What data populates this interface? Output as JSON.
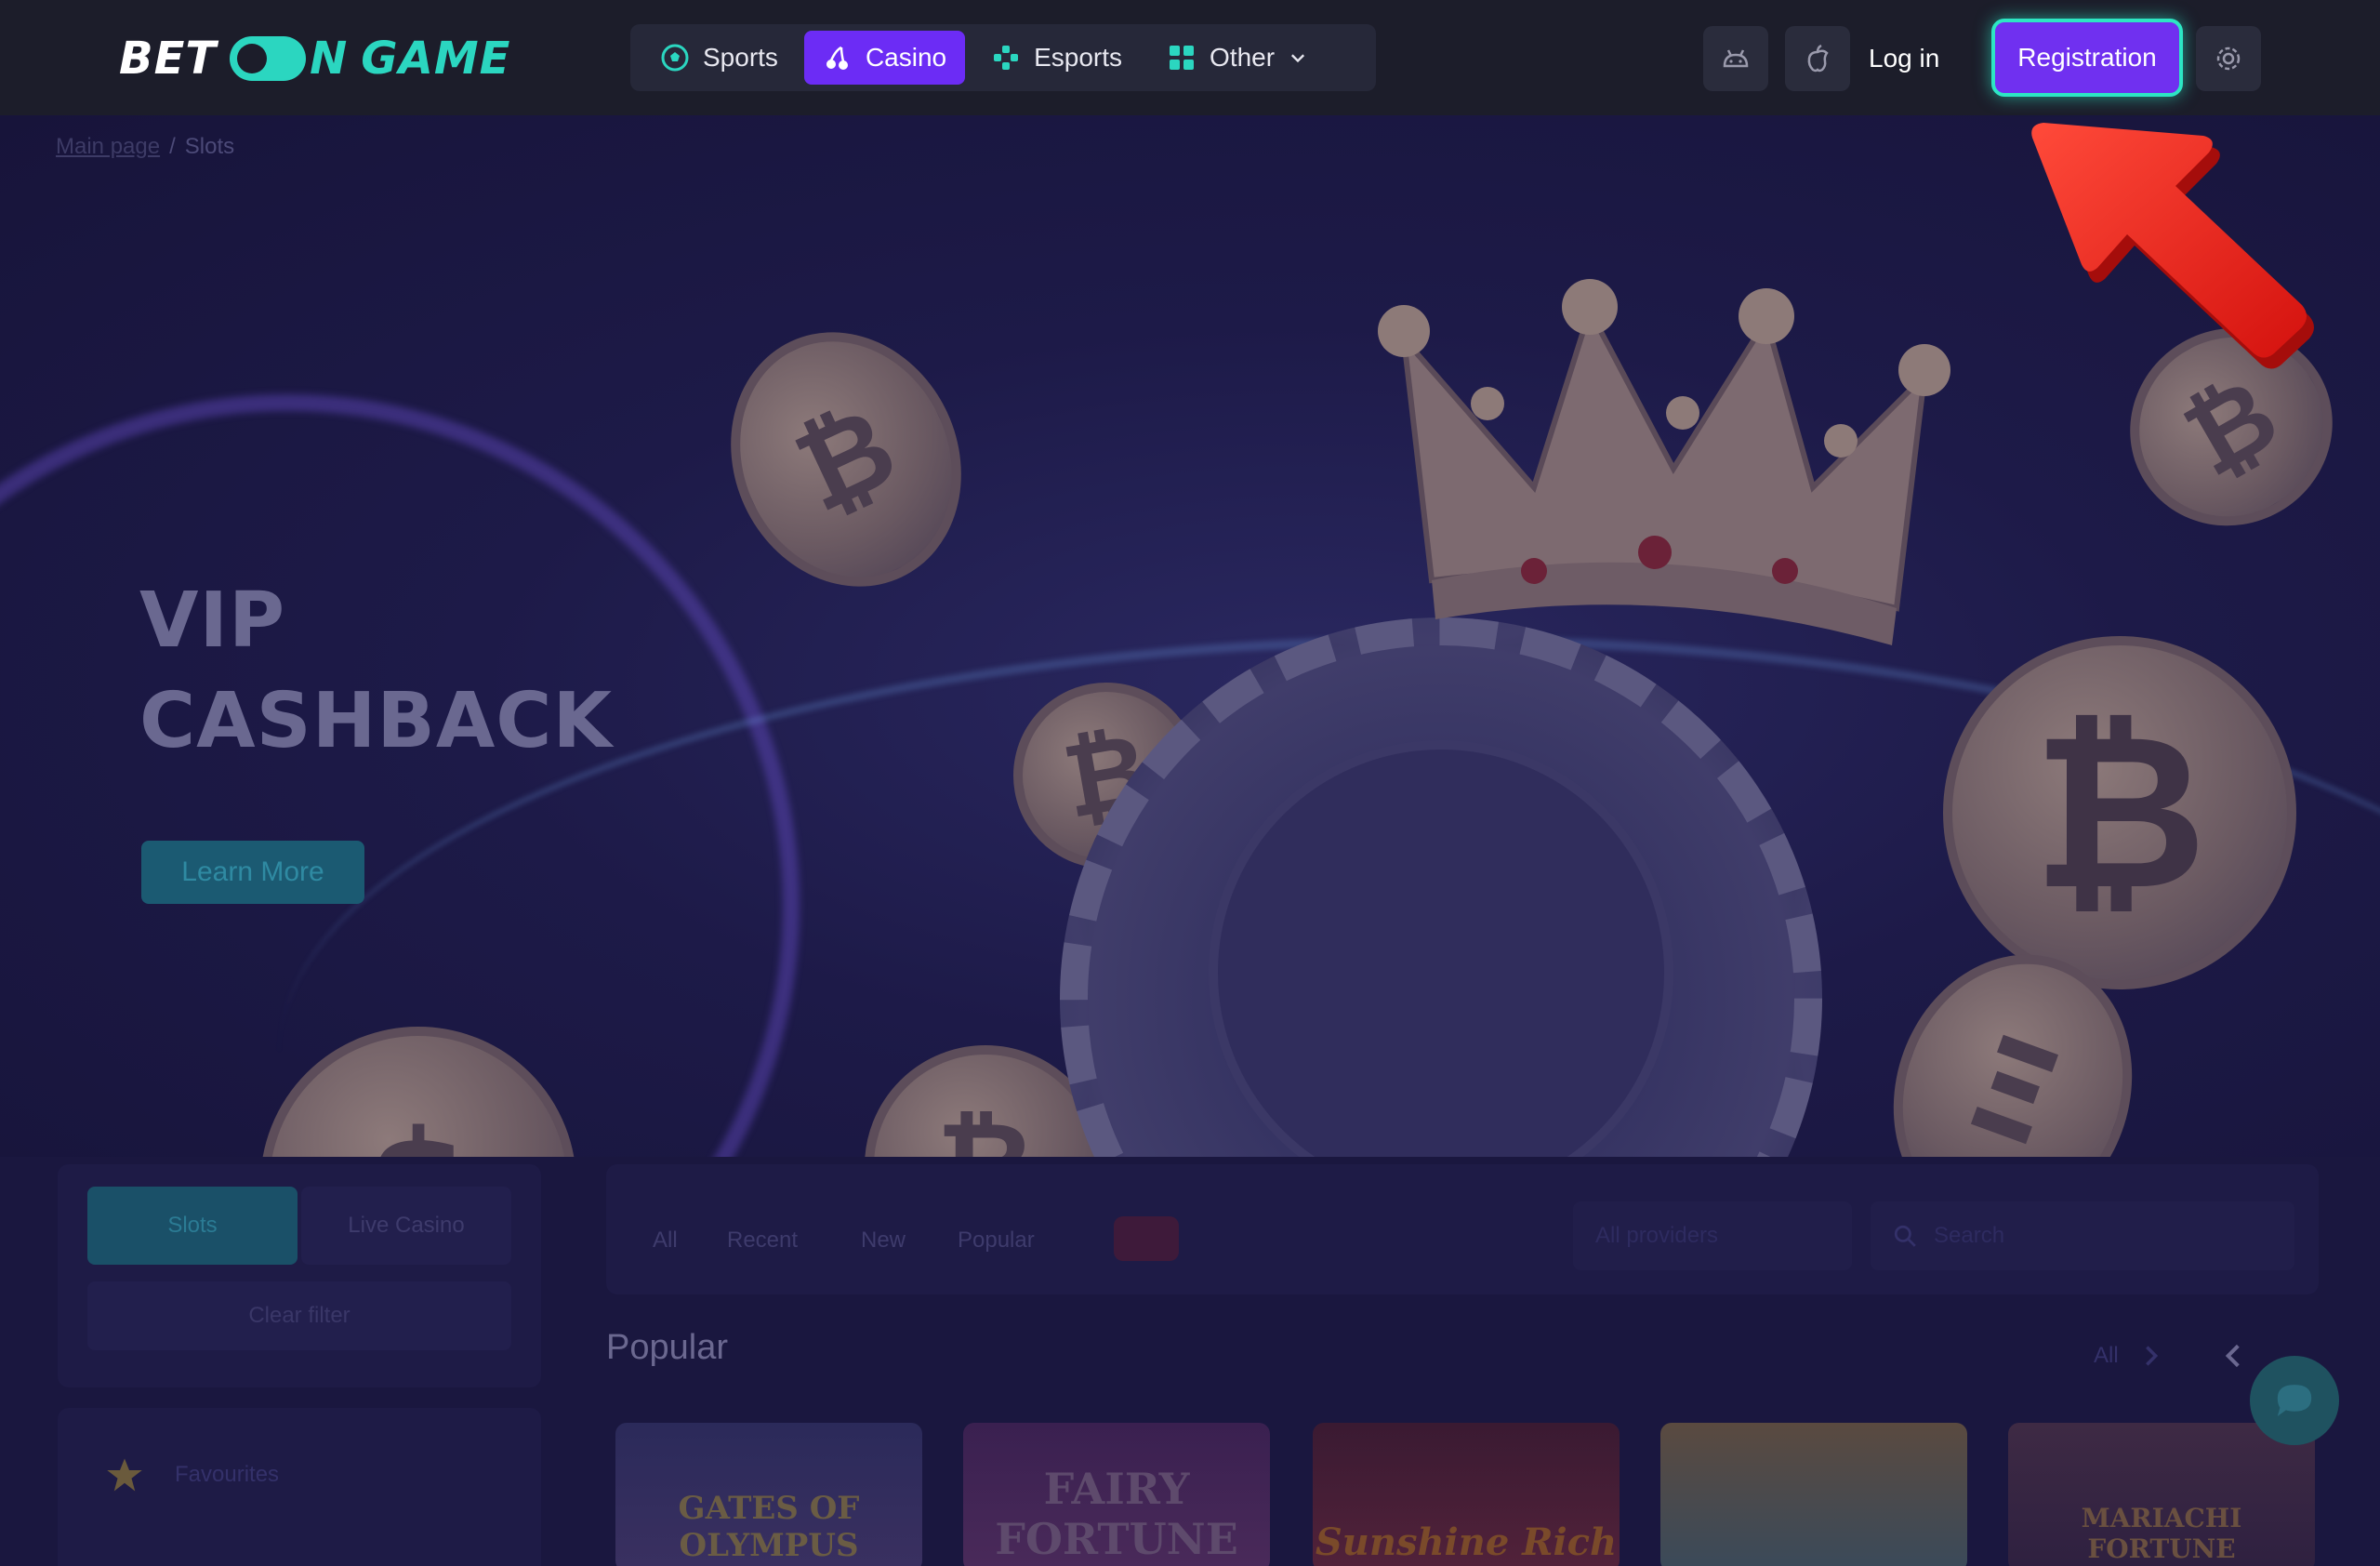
{
  "brand": {
    "logo_left": "BET",
    "logo_on": "N",
    "logo_right": "GAME",
    "accent_color": "#2bd6c0",
    "primary_color": "#6c2cf5"
  },
  "nav": {
    "items": [
      {
        "label": "Sports",
        "icon": "soccer-ball-icon"
      },
      {
        "label": "Casino",
        "icon": "cherries-icon",
        "active": true
      },
      {
        "label": "Esports",
        "icon": "gamepad-icon"
      },
      {
        "label": "Other",
        "icon": "grid-icon"
      }
    ]
  },
  "header": {
    "android_icon": "android-icon",
    "apple_icon": "apple-icon",
    "login_label": "Log in",
    "register_label": "Registration",
    "settings_icon": "gear-icon"
  },
  "breadcrumb": {
    "home": "Main page",
    "separator": "/",
    "current": "Slots"
  },
  "hero": {
    "title_line1": "VIP",
    "title_line2": "CASHBACK",
    "cta_label": "Learn More"
  },
  "lobby": {
    "categories": [
      "Slots",
      "Live Casino"
    ],
    "clear_filter": "Clear filter",
    "favourites": "Favourites",
    "filter_tabs": [
      "All",
      "Recent",
      "New",
      "Popular"
    ],
    "providers_label": "All providers",
    "search_placeholder": "Search",
    "section_title": "Popular",
    "all_label": "All",
    "games": [
      {
        "name": "GATES OF OLYMPUS"
      },
      {
        "name": "FAIRY FORTUNE"
      },
      {
        "name": "Sunshine Rich"
      },
      {
        "name": ""
      },
      {
        "name": "MARIACHI FORTUNE"
      }
    ]
  }
}
